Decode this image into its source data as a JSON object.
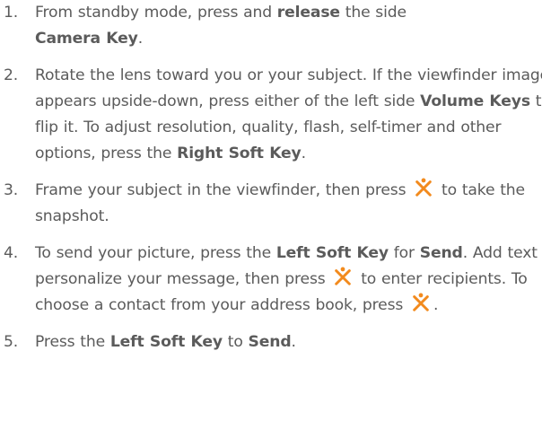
{
  "icon": {
    "name": "ok-key-icon",
    "color": "#f28a1d"
  },
  "steps": [
    {
      "num": "1.",
      "t1": "From standby mode, press and ",
      "b1": "release",
      "t2": " the side ",
      "b2": "Camera Key",
      "t3": "."
    },
    {
      "num": "2.",
      "t1": "Rotate the lens toward you or your subject. If the viewfinder image appears upside-down, press either of the left side ",
      "b1": "Volume Keys",
      "t2": " to flip it. To adjust resolution, quality, flash, self-timer and other options, press the ",
      "b2": "Right Soft Key",
      "t3": "."
    },
    {
      "num": "3.",
      "t1": "Frame your subject in the viewfinder, then press ",
      "t2": " to take the snapshot."
    },
    {
      "num": "4.",
      "t1": "To send your picture, press the ",
      "b1": "Left Soft Key",
      "t2": " for ",
      "b2": "Send",
      "t3": ". Add text to personalize your message, then press ",
      "t4": " to enter recipients. To choose a contact from your address book, press ",
      "t5": "."
    },
    {
      "num": "5.",
      "t1": "Press the ",
      "b1": "Left Soft Key",
      "t2": " to ",
      "b2": "Send",
      "t3": "."
    }
  ]
}
